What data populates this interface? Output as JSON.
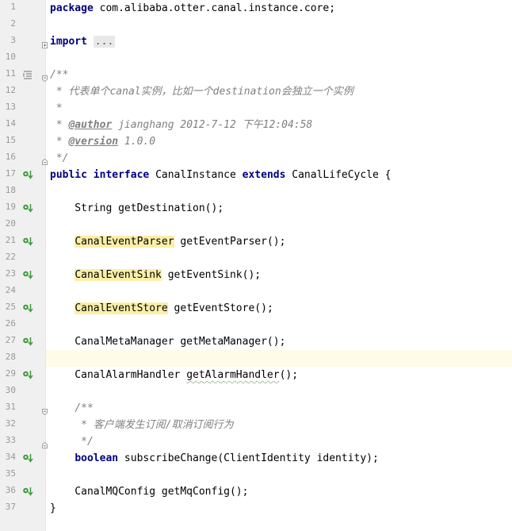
{
  "editor": {
    "language": "java",
    "current_line": 28,
    "colors": {
      "keyword": "#000080",
      "comment": "#808080",
      "highlight": "#fbefa8",
      "gutter_bg": "#f0f0f0",
      "current_line_bg": "#fefbe9",
      "implement_icon": "#3f9b3f"
    },
    "lines": [
      {
        "n": "1",
        "marker": "",
        "fold": "",
        "segs": [
          {
            "t": "package",
            "c": "kw"
          },
          {
            "t": " com.alibaba.otter.canal.instance.core;",
            "c": ""
          }
        ]
      },
      {
        "n": "2",
        "marker": "",
        "fold": "",
        "segs": []
      },
      {
        "n": "3",
        "marker": "",
        "fold": "plus",
        "segs": [
          {
            "t": "import",
            "c": "kw"
          },
          {
            "t": " ",
            "c": ""
          },
          {
            "t": "...",
            "c": "fold-box"
          }
        ]
      },
      {
        "n": "10",
        "marker": "",
        "fold": "",
        "segs": []
      },
      {
        "n": "11",
        "marker": "doc",
        "fold": "minus",
        "segs": [
          {
            "t": "/**",
            "c": "cm"
          }
        ]
      },
      {
        "n": "12",
        "marker": "",
        "fold": "",
        "segs": [
          {
            "t": " * 代表单个canal实例，比如一个destination会独立一个实例",
            "c": "cm"
          }
        ]
      },
      {
        "n": "13",
        "marker": "",
        "fold": "",
        "segs": [
          {
            "t": " *",
            "c": "cm"
          }
        ]
      },
      {
        "n": "14",
        "marker": "",
        "fold": "",
        "segs": [
          {
            "t": " * ",
            "c": "cm"
          },
          {
            "t": "@author",
            "c": "tag"
          },
          {
            "t": " jianghang 2012-7-12 下午12:04:58",
            "c": "cm"
          }
        ]
      },
      {
        "n": "15",
        "marker": "",
        "fold": "",
        "segs": [
          {
            "t": " * ",
            "c": "cm"
          },
          {
            "t": "@version",
            "c": "tag"
          },
          {
            "t": " 1.0.0",
            "c": "cm"
          }
        ]
      },
      {
        "n": "16",
        "marker": "",
        "fold": "end",
        "segs": [
          {
            "t": " */",
            "c": "cm"
          }
        ]
      },
      {
        "n": "17",
        "marker": "impl",
        "fold": "",
        "segs": [
          {
            "t": "public",
            "c": "kw"
          },
          {
            "t": " ",
            "c": ""
          },
          {
            "t": "interface",
            "c": "kw"
          },
          {
            "t": " CanalInstance ",
            "c": ""
          },
          {
            "t": "extends",
            "c": "kw"
          },
          {
            "t": " CanalLifeCycle {",
            "c": ""
          }
        ]
      },
      {
        "n": "18",
        "marker": "",
        "fold": "",
        "segs": []
      },
      {
        "n": "19",
        "marker": "impl",
        "fold": "",
        "segs": [
          {
            "t": "    String getDestination();",
            "c": ""
          }
        ]
      },
      {
        "n": "20",
        "marker": "",
        "fold": "",
        "segs": []
      },
      {
        "n": "21",
        "marker": "impl",
        "fold": "",
        "segs": [
          {
            "t": "    ",
            "c": ""
          },
          {
            "t": "CanalEventParser",
            "c": "hl"
          },
          {
            "t": " getEventParser();",
            "c": ""
          }
        ]
      },
      {
        "n": "22",
        "marker": "",
        "fold": "",
        "segs": []
      },
      {
        "n": "23",
        "marker": "impl",
        "fold": "",
        "segs": [
          {
            "t": "    ",
            "c": ""
          },
          {
            "t": "CanalEventSink",
            "c": "hl"
          },
          {
            "t": " getEventSink();",
            "c": ""
          }
        ]
      },
      {
        "n": "24",
        "marker": "",
        "fold": "",
        "segs": []
      },
      {
        "n": "25",
        "marker": "impl",
        "fold": "",
        "segs": [
          {
            "t": "    ",
            "c": ""
          },
          {
            "t": "CanalEventStore",
            "c": "hl"
          },
          {
            "t": " getEventStore();",
            "c": ""
          }
        ]
      },
      {
        "n": "26",
        "marker": "",
        "fold": "",
        "segs": []
      },
      {
        "n": "27",
        "marker": "impl",
        "fold": "",
        "segs": [
          {
            "t": "    CanalMetaManager getMetaManager();",
            "c": ""
          }
        ]
      },
      {
        "n": "28",
        "marker": "",
        "fold": "",
        "segs": []
      },
      {
        "n": "29",
        "marker": "impl",
        "fold": "",
        "segs": [
          {
            "t": "    CanalAlarmHandler ",
            "c": ""
          },
          {
            "t": "getAlarmHandler",
            "c": "squig"
          },
          {
            "t": "();",
            "c": ""
          }
        ]
      },
      {
        "n": "30",
        "marker": "",
        "fold": "",
        "segs": []
      },
      {
        "n": "31",
        "marker": "",
        "fold": "minus",
        "segs": [
          {
            "t": "    /**",
            "c": "cm"
          }
        ]
      },
      {
        "n": "32",
        "marker": "",
        "fold": "",
        "segs": [
          {
            "t": "     * 客户端发生订阅/取消订阅行为",
            "c": "cm"
          }
        ]
      },
      {
        "n": "33",
        "marker": "",
        "fold": "end",
        "segs": [
          {
            "t": "     */",
            "c": "cm"
          }
        ]
      },
      {
        "n": "34",
        "marker": "impl",
        "fold": "",
        "segs": [
          {
            "t": "    ",
            "c": ""
          },
          {
            "t": "boolean",
            "c": "kw"
          },
          {
            "t": " subscribeChange(ClientIdentity identity);",
            "c": ""
          }
        ]
      },
      {
        "n": "35",
        "marker": "",
        "fold": "",
        "segs": []
      },
      {
        "n": "36",
        "marker": "impl",
        "fold": "",
        "segs": [
          {
            "t": "    CanalMQConfig getMqConfig();",
            "c": ""
          }
        ]
      },
      {
        "n": "37",
        "marker": "",
        "fold": "",
        "segs": [
          {
            "t": "}",
            "c": ""
          }
        ]
      }
    ]
  }
}
